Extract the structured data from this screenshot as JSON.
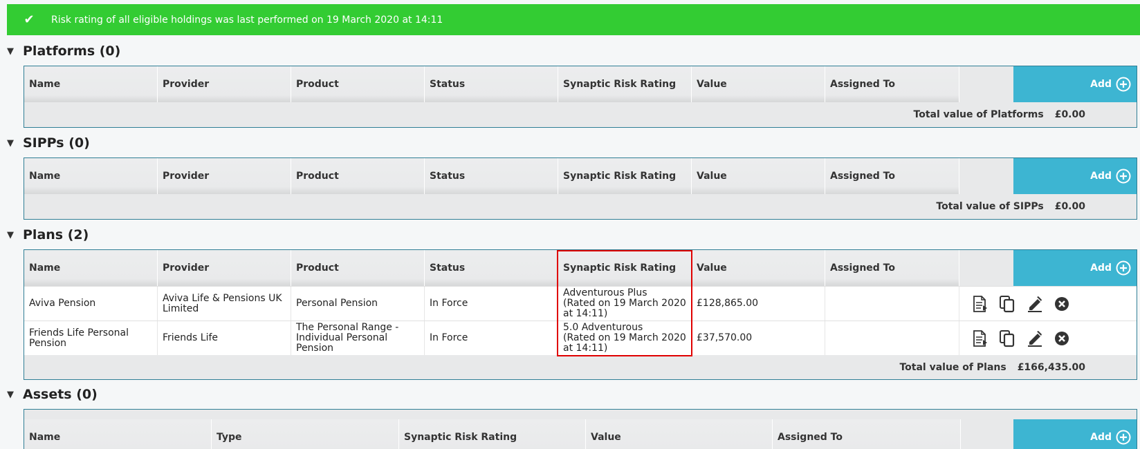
{
  "banner": {
    "message": "Risk rating of all eligible holdings was last performed on 19 March 2020 at 14:11"
  },
  "columns": [
    "Name",
    "Provider",
    "Product",
    "Status",
    "Synaptic Risk Rating",
    "Value",
    "Assigned To"
  ],
  "add_label": "Add",
  "sections": {
    "platforms": {
      "title": "Platforms (0)",
      "total_label": "Total value of Platforms",
      "total_value": "£0.00"
    },
    "sipps": {
      "title": "SIPPs (0)",
      "total_label": "Total value of SIPPs",
      "total_value": "£0.00"
    },
    "plans": {
      "title": "Plans (2)",
      "total_label": "Total value of Plans",
      "total_value": "£166,435.00",
      "rows": [
        {
          "name": "Aviva Pension",
          "provider": "Aviva Life & Pensions UK Limited",
          "product": "Personal Pension",
          "status": "In Force",
          "risk": "Adventurous Plus",
          "risk_note": "(Rated on 19 March 2020 at 14:11)",
          "value": "£128,865.00",
          "assigned": ""
        },
        {
          "name": "Friends Life Personal Pension",
          "provider": "Friends Life",
          "product": "The Personal Range - Individual Personal Pension",
          "status": "In Force",
          "risk": "5.0 Adventurous",
          "risk_note": "(Rated on 19 March 2020 at 14:11)",
          "value": "£37,570.00",
          "assigned": ""
        }
      ]
    },
    "assets": {
      "title": "Assets (0)",
      "columns": [
        "Name",
        "Type",
        "Synaptic Risk Rating",
        "Value",
        "Assigned To"
      ]
    }
  },
  "icons": {
    "check": "check-icon",
    "caret": "caret-down-icon",
    "add": "plus-circle-icon",
    "view": "document-icon",
    "copy": "copy-icon",
    "edit": "edit-icon",
    "delete": "close-circle-icon"
  },
  "colors": {
    "banner": "#33cc33",
    "add_header": "#3db5d2",
    "border": "#2f7e95",
    "highlight": "#e00000"
  }
}
